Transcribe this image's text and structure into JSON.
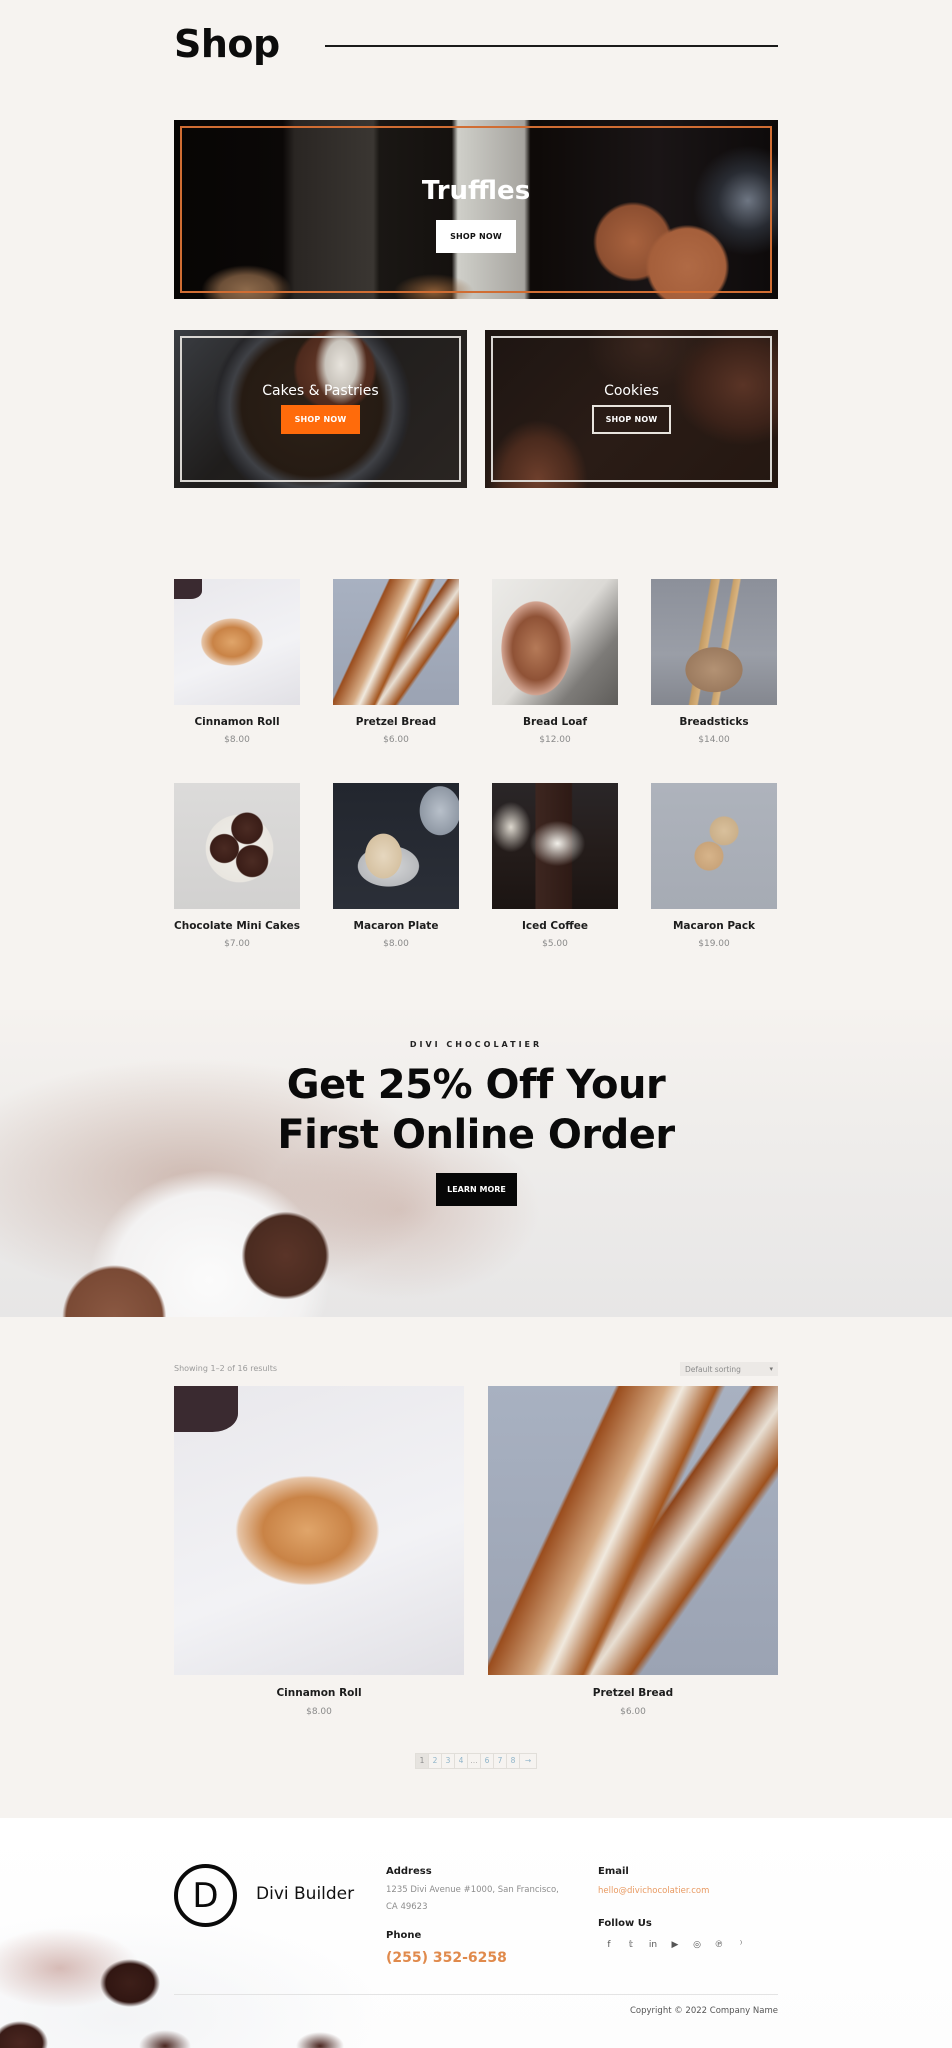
{
  "header": {
    "title": "Shop"
  },
  "categories": [
    {
      "title": "Truffles",
      "button": "SHOP NOW"
    },
    {
      "title": "Cakes & Pastries",
      "button": "SHOP NOW"
    },
    {
      "title": "Cookies",
      "button": "SHOP NOW"
    }
  ],
  "products": [
    {
      "name": "Cinnamon Roll",
      "price": "$8.00"
    },
    {
      "name": "Pretzel Bread",
      "price": "$6.00"
    },
    {
      "name": "Bread Loaf",
      "price": "$12.00"
    },
    {
      "name": "Breadsticks",
      "price": "$14.00"
    },
    {
      "name": "Chocolate Mini Cakes",
      "price": "$7.00"
    },
    {
      "name": "Macaron Plate",
      "price": "$8.00"
    },
    {
      "name": "Iced Coffee",
      "price": "$5.00"
    },
    {
      "name": "Macaron Pack",
      "price": "$19.00"
    }
  ],
  "promo": {
    "eyebrow": "DIVI CHOCOLATIER",
    "headline_line1": "Get 25% Off Your",
    "headline_line2": "First Online Order",
    "button": "LEARN MORE"
  },
  "results": {
    "count_text": "Showing 1–2 of 16 results",
    "sort_selected": "Default sorting",
    "items": [
      {
        "name": "Cinnamon Roll",
        "price": "$8.00"
      },
      {
        "name": "Pretzel Bread",
        "price": "$6.00"
      }
    ],
    "pagination": [
      "1",
      "2",
      "3",
      "4",
      "…",
      "6",
      "7",
      "8",
      "→"
    ],
    "current_page": "1"
  },
  "footer": {
    "logo_letter": "D",
    "brand": "Divi Builder",
    "address_heading": "Address",
    "address_line1": "1235 Divi Avenue #1000, San Francisco,",
    "address_line2": "CA 49623",
    "phone_heading": "Phone",
    "phone": "(255) 352-6258",
    "email_heading": "Email",
    "email": "hello@divichocolatier.com",
    "follow_heading": "Follow Us",
    "socials": [
      "facebook",
      "twitter",
      "linkedin",
      "youtube",
      "instagram",
      "pinterest",
      "rss"
    ],
    "social_glyphs": [
      "f",
      "𝕥",
      "in",
      "▶",
      "◎",
      "℗",
      "⁾"
    ],
    "copyright": "Copyright © 2022 Company Name"
  },
  "colors": {
    "accent_orange": "#ff6b0b",
    "phone_orange": "#e08a4c",
    "background": "#f6f3f0"
  }
}
